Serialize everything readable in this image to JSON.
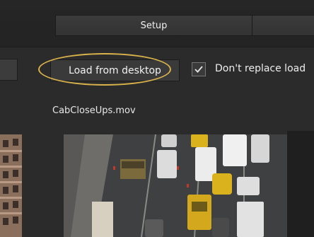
{
  "tabs": {
    "setup_label": "Setup",
    "right_label": ""
  },
  "toolbar": {
    "load_button_label": "Load from desktop",
    "dont_replace_checked": true,
    "dont_replace_label": "Don't replace load"
  },
  "clip": {
    "filename": "CabCloseUps.mov"
  },
  "colors": {
    "highlight": "#d8b24a",
    "background": "#2b2b2b",
    "taxi_yellow": "#d9b21e"
  },
  "icons": {
    "checkbox": "checkmark-icon"
  }
}
